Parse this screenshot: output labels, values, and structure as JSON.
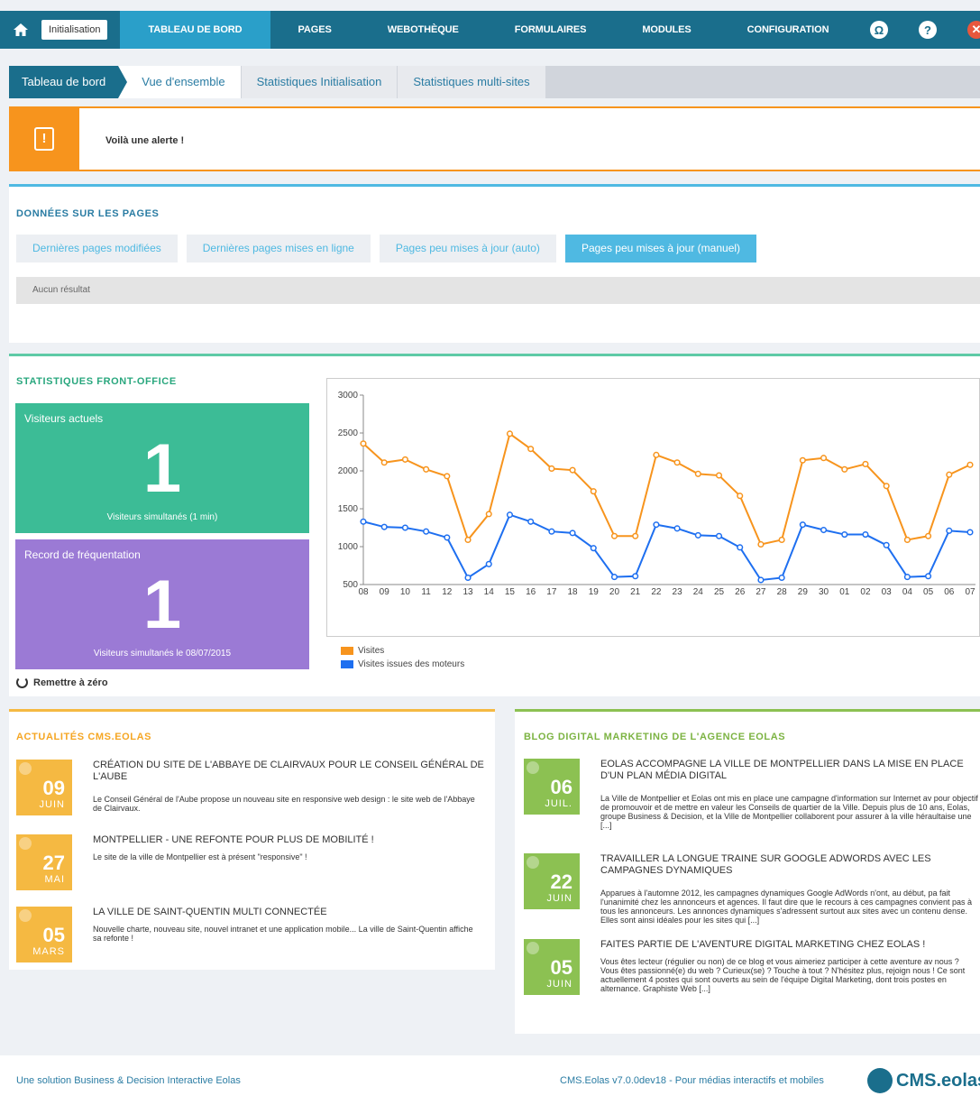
{
  "topnav": {
    "init_button": "Initialisation",
    "items": [
      "TABLEAU DE BORD",
      "PAGES",
      "WEBOTHÈQUE",
      "FORMULAIRES",
      "MODULES",
      "CONFIGURATION"
    ]
  },
  "tabs": [
    "Tableau de bord",
    "Vue d'ensemble",
    "Statistiques Initialisation",
    "Statistiques multi-sites"
  ],
  "alert": {
    "text": "Voilà une alerte !"
  },
  "pages_section": {
    "title": "DONNÉES SUR LES PAGES",
    "pills": [
      "Dernières pages modifiées",
      "Dernières pages mises en ligne",
      "Pages peu mises à jour (auto)",
      "Pages peu mises à jour (manuel)"
    ],
    "no_result": "Aucun résultat"
  },
  "stats_section": {
    "title": "STATISTIQUES FRONT-OFFICE",
    "current": {
      "label": "Visiteurs actuels",
      "value": "1",
      "sub": "Visiteurs simultanés (1 min)"
    },
    "record": {
      "label": "Record de fréquentation",
      "value": "1",
      "sub": "Visiteurs simultanés le 08/07/2015"
    },
    "reset": "Remettre à zéro"
  },
  "chart_data": {
    "type": "line",
    "x": [
      "08",
      "09",
      "10",
      "11",
      "12",
      "13",
      "14",
      "15",
      "16",
      "17",
      "18",
      "19",
      "20",
      "21",
      "22",
      "23",
      "24",
      "25",
      "26",
      "27",
      "28",
      "29",
      "30",
      "01",
      "02",
      "03",
      "04",
      "05",
      "06",
      "07"
    ],
    "ylim": [
      500,
      3000
    ],
    "yticks": [
      "500",
      "1000",
      "1500",
      "2000",
      "2500",
      "3000"
    ],
    "series": [
      {
        "name": "Visites",
        "color": "#f7941d",
        "values": [
          2360,
          2110,
          2150,
          2020,
          1930,
          1090,
          1430,
          2490,
          2290,
          2030,
          2010,
          1730,
          1140,
          1140,
          2210,
          2110,
          1960,
          1940,
          1670,
          1030,
          1090,
          2140,
          2170,
          2020,
          2090,
          1800,
          1090,
          1140,
          1950,
          2080
        ]
      },
      {
        "name": "Visites issues des moteurs",
        "color": "#1e6ff0",
        "values": [
          1330,
          1260,
          1250,
          1200,
          1120,
          590,
          770,
          1420,
          1330,
          1200,
          1180,
          980,
          600,
          610,
          1290,
          1240,
          1150,
          1140,
          990,
          560,
          590,
          1290,
          1220,
          1160,
          1160,
          1020,
          600,
          610,
          1210,
          1190
        ]
      }
    ]
  },
  "news1": {
    "title": "ACTUALITÉS CMS.EOLAS",
    "items": [
      {
        "day": "09",
        "month": "JUIN",
        "title": "CRÉATION DU SITE DE L'ABBAYE DE CLAIRVAUX POUR LE CONSEIL GÉNÉRAL DE L'AUBE",
        "desc": "Le Conseil Général de l'Aube propose un nouveau site en responsive web design : le site web de l'Abbaye de Clairvaux."
      },
      {
        "day": "27",
        "month": "MAI",
        "title": "MONTPELLIER - UNE REFONTE POUR PLUS DE MOBILITÉ !",
        "desc": "Le site de la ville de Montpellier est à présent \"responsive\" !"
      },
      {
        "day": "05",
        "month": "MARS",
        "title": "LA VILLE DE SAINT-QUENTIN MULTI CONNECTÉE",
        "desc": "Nouvelle charte, nouveau site, nouvel intranet et une application mobile... La ville de Saint-Quentin affiche sa refonte !"
      }
    ]
  },
  "news2": {
    "title": "BLOG DIGITAL MARKETING DE L'AGENCE EOLAS",
    "items": [
      {
        "day": "06",
        "month": "JUIL.",
        "title": "EOLAS ACCOMPAGNE LA VILLE DE MONTPELLIER DANS LA MISE EN PLACE D'UN PLAN MÉDIA DIGITAL",
        "desc": "La Ville de Montpellier et Eolas ont mis en place une campagne d'information sur Internet av pour objectif de promouvoir et de mettre en valeur les Conseils de quartier de la Ville. Depuis plus de 10 ans, Eolas, groupe Business & Decision, et la Ville de Montpellier collaborent pour assurer à la ville héraultaise une [...]"
      },
      {
        "day": "22",
        "month": "JUIN",
        "title": "TRAVAILLER LA LONGUE TRAINE SUR GOOGLE ADWORDS AVEC LES CAMPAGNES DYNAMIQUES",
        "desc": "Apparues à l'automne 2012, les campagnes dynamiques Google AdWords n'ont, au début, pa fait l'unanimité chez les annonceurs et agences. Il faut dire que le recours à ces campagnes convient pas à tous les annonceurs. Les annonces dynamiques s'adressent surtout aux sites avec un contenu dense. Elles sont ainsi idéales pour les sites qui [...]"
      },
      {
        "day": "05",
        "month": "JUIN",
        "title": "FAITES PARTIE DE L'AVENTURE DIGITAL MARKETING CHEZ EOLAS !",
        "desc": "Vous êtes lecteur (régulier ou non) de ce blog et vous aimeriez participer à cette aventure av nous ? Vous êtes passionné(e) du web ? Curieux(se) ? Touche à tout ? N'hésitez plus, rejoign nous ! Ce sont actuellement 4 postes qui sont ouverts au sein de l'équipe Digital Marketing, dont trois postes en alternance. Graphiste Web [...]"
      }
    ]
  },
  "footer": {
    "left": "Une solution Business & Decision Interactive Eolas",
    "right": "CMS.Eolas v7.0.0dev18 - Pour médias interactifs et mobiles",
    "logo": "CMS.eolas"
  }
}
